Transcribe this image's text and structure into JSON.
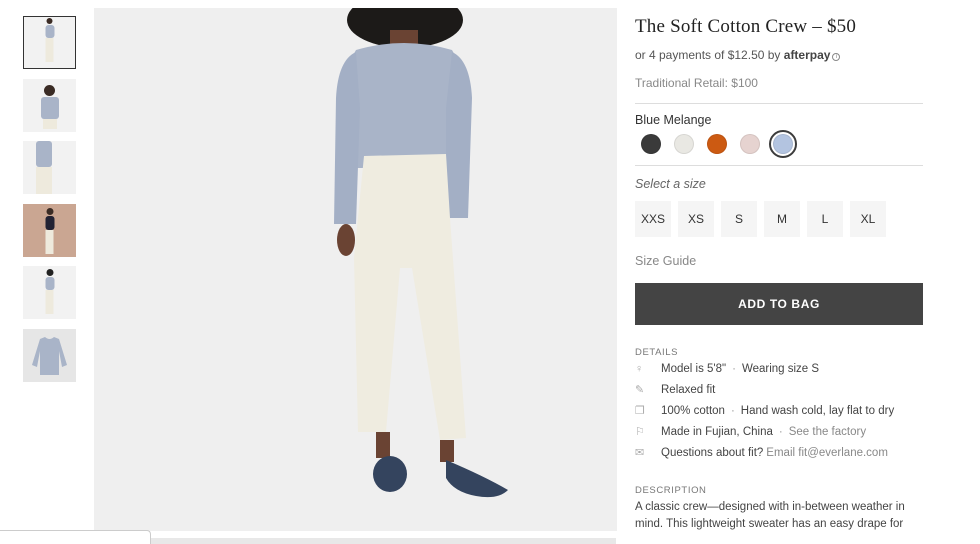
{
  "product": {
    "title": "The Soft Cotton Crew – $50",
    "afterpay_text": "or 4 payments of $12.50 by ",
    "afterpay_brand": "afterpay",
    "afterpay_info": "i",
    "traditional_retail": "Traditional Retail: $100"
  },
  "color": {
    "selected_name": "Blue Melange",
    "swatches": [
      {
        "name": "Charcoal",
        "hex": "#3a3a3a"
      },
      {
        "name": "Bone",
        "hex": "#e9e8e3"
      },
      {
        "name": "Orange",
        "hex": "#cc5a12"
      },
      {
        "name": "Pink",
        "hex": "#e6d3d0"
      },
      {
        "name": "Blue Melange",
        "hex": "#b3c4e0"
      }
    ]
  },
  "size": {
    "prompt": "Select a size",
    "options": [
      "XXS",
      "XS",
      "S",
      "M",
      "L",
      "XL"
    ],
    "guide": "Size Guide"
  },
  "cta": {
    "add_to_bag": "ADD TO BAG"
  },
  "details": {
    "label": "DETAILS",
    "rows": [
      {
        "icon": "person-icon",
        "text": "Model is 5'8\"",
        "extra": "Wearing size S"
      },
      {
        "icon": "pencil-icon",
        "text": "Relaxed fit",
        "extra": ""
      },
      {
        "icon": "tag-icon",
        "text": "100% cotton",
        "extra": "Hand wash cold, lay flat to dry"
      },
      {
        "icon": "location-pin-icon",
        "text": "Made in Fujian, China",
        "extra": "See the factory"
      },
      {
        "icon": "envelope-icon",
        "text": "Questions about fit?",
        "extra": "Email fit@everlane.com"
      }
    ]
  },
  "description": {
    "label": "DESCRIPTION",
    "text": "A classic crew—designed with in-between weather in mind. This lightweight sweater has an easy drape for"
  },
  "thumbnails": [
    {
      "alt": "front view"
    },
    {
      "alt": "front crop"
    },
    {
      "alt": "sleeve detail"
    },
    {
      "alt": "walking lifestyle"
    },
    {
      "alt": "back view"
    },
    {
      "alt": "flat lay"
    }
  ],
  "colors": {
    "button_bg": "#444444",
    "sweater": "#a9b4c8",
    "pants": "#efece0",
    "shoes": "#34445e",
    "hero_bg": "#efefef"
  }
}
